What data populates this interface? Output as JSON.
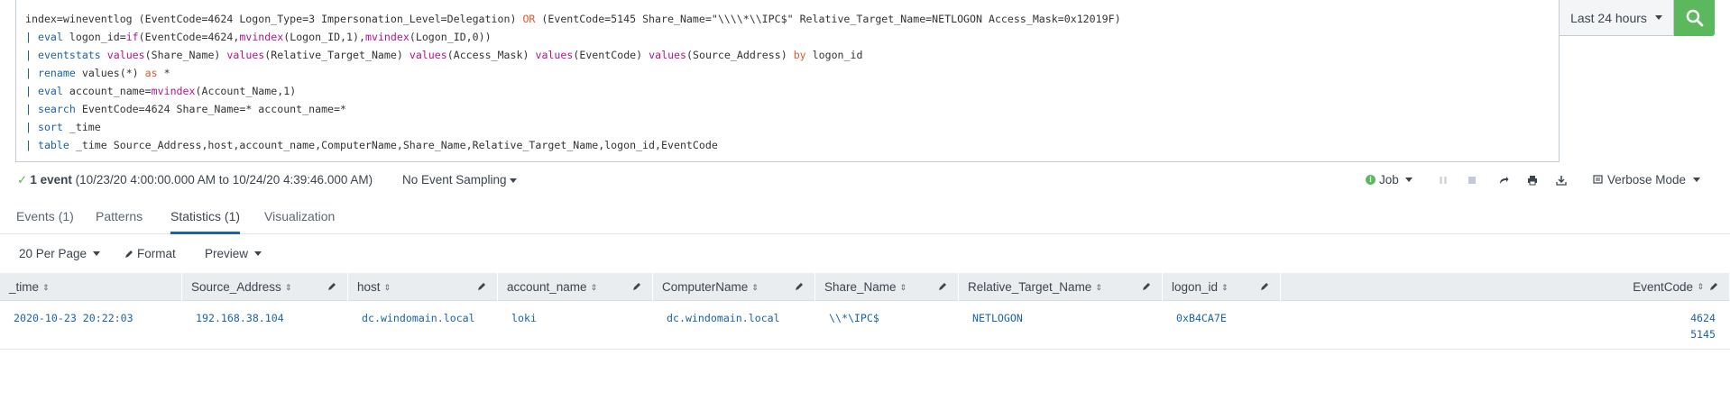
{
  "search": {
    "lines": [
      [
        {
          "t": "index=wineventlog (EventCode=4624 Logon_Type=3 Impersonation_Level=Delegation) ",
          "c": ""
        },
        {
          "t": "OR",
          "c": "op"
        },
        {
          "t": " (EventCode=5145 Share_Name=\"\\\\\\\\*\\\\IPC$\" Relative_Target_Name=NETLOGON Access_Mask=0x12019F)",
          "c": ""
        }
      ],
      [
        {
          "t": "| ",
          "c": "pipe"
        },
        {
          "t": "eval",
          "c": "kw"
        },
        {
          "t": " logon_id=",
          "c": ""
        },
        {
          "t": "if",
          "c": "fn"
        },
        {
          "t": "(EventCode=4624,",
          "c": ""
        },
        {
          "t": "mvindex",
          "c": "fn"
        },
        {
          "t": "(Logon_ID,1),",
          "c": ""
        },
        {
          "t": "mvindex",
          "c": "fn"
        },
        {
          "t": "(Logon_ID,0))",
          "c": ""
        }
      ],
      [
        {
          "t": "| ",
          "c": "pipe"
        },
        {
          "t": "eventstats",
          "c": "kw"
        },
        {
          "t": " ",
          "c": ""
        },
        {
          "t": "values",
          "c": "fn"
        },
        {
          "t": "(Share_Name) ",
          "c": ""
        },
        {
          "t": "values",
          "c": "fn"
        },
        {
          "t": "(Relative_Target_Name) ",
          "c": ""
        },
        {
          "t": "values",
          "c": "fn"
        },
        {
          "t": "(Access_Mask) ",
          "c": ""
        },
        {
          "t": "values",
          "c": "fn"
        },
        {
          "t": "(EventCode) ",
          "c": ""
        },
        {
          "t": "values",
          "c": "fn"
        },
        {
          "t": "(Source_Address) ",
          "c": ""
        },
        {
          "t": "by",
          "c": "op"
        },
        {
          "t": " logon_id",
          "c": ""
        }
      ],
      [
        {
          "t": "| ",
          "c": "pipe"
        },
        {
          "t": "rename",
          "c": "kw"
        },
        {
          "t": " values(*) ",
          "c": ""
        },
        {
          "t": "as",
          "c": "op"
        },
        {
          "t": " *",
          "c": ""
        }
      ],
      [
        {
          "t": "| ",
          "c": "pipe"
        },
        {
          "t": "eval",
          "c": "kw"
        },
        {
          "t": " account_name=",
          "c": ""
        },
        {
          "t": "mvindex",
          "c": "fn"
        },
        {
          "t": "(Account_Name,1)",
          "c": ""
        }
      ],
      [
        {
          "t": "| ",
          "c": "pipe"
        },
        {
          "t": "search",
          "c": "kw"
        },
        {
          "t": " EventCode=4624 Share_Name=* account_name=*",
          "c": ""
        }
      ],
      [
        {
          "t": "| ",
          "c": "pipe"
        },
        {
          "t": "sort",
          "c": "kw"
        },
        {
          "t": " _time",
          "c": ""
        }
      ],
      [
        {
          "t": "| ",
          "c": "pipe"
        },
        {
          "t": "table",
          "c": "kw"
        },
        {
          "t": " _time Source_Address,host,account_name,ComputerName,Share_Name,Relative_Target_Name,logon_id,EventCode",
          "c": ""
        }
      ]
    ],
    "time_range": "Last 24 hours"
  },
  "status": {
    "count_bold": "1 event",
    "count_range": " (10/23/20 4:00:00.000 AM to 10/24/20 4:39:46.000 AM)",
    "sampling": "No Event Sampling",
    "job": "Job",
    "mode": "Verbose Mode"
  },
  "tabs": [
    "Events (1)",
    "Patterns",
    "Statistics (1)",
    "Visualization"
  ],
  "toolbar": {
    "per_page": "20 Per Page",
    "format": "Format",
    "preview": "Preview"
  },
  "table": {
    "columns": [
      "_time",
      "Source_Address",
      "host",
      "account_name",
      "ComputerName",
      "Share_Name",
      "Relative_Target_Name",
      "logon_id",
      "EventCode"
    ],
    "rows": [
      [
        "2020-10-23 20:22:03",
        "192.168.38.104",
        "dc.windomain.local",
        "loki",
        "dc.windomain.local",
        "\\\\*\\IPC$",
        "NETLOGON",
        "0xB4CA7E",
        "4624\n5145"
      ]
    ]
  },
  "colors": {
    "accent": "#1a63a8",
    "search_button": "#5cb85c",
    "keyword": "#1a63a8",
    "function": "#b5148e",
    "operator": "#e0592a"
  }
}
